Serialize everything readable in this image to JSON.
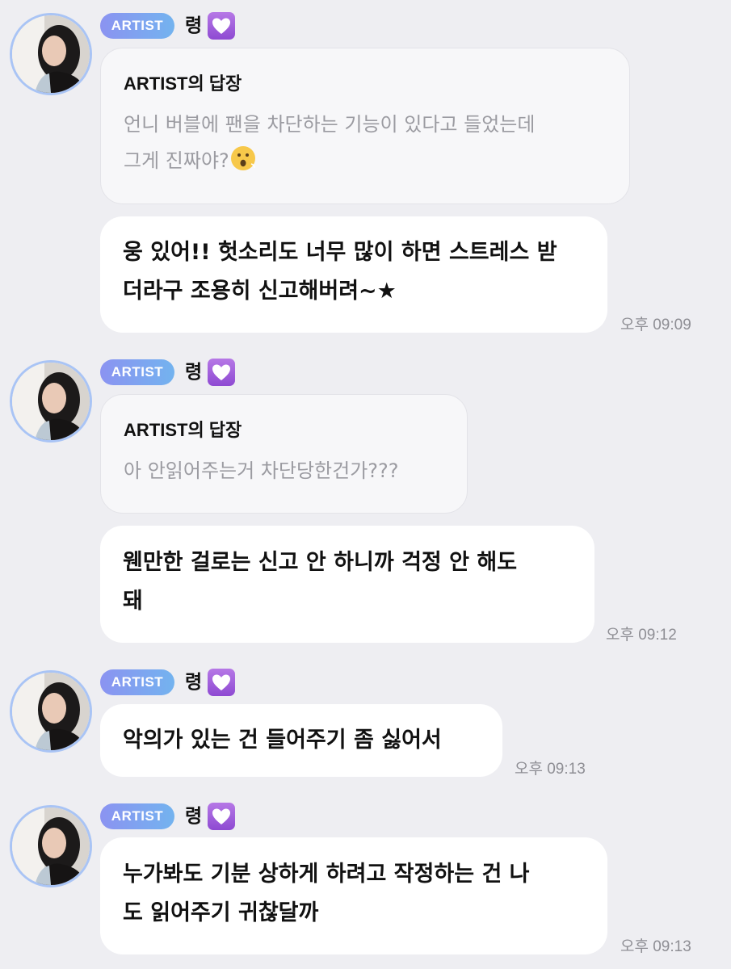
{
  "groups": [
    {
      "badge": "ARTIST",
      "username": "령",
      "reply": {
        "title": "ARTIST의 답장",
        "text": "언니 버블에 팬을 차단하는 기능이 있다고 들었는데\n그게 진짜야?",
        "emoji": "hushed-face-icon"
      },
      "message": "웅 있어!! 헛소리도 너무 많이 하면 스트레스 받\n더라구 조용히 신고해버려~★",
      "time": "오후 09:09"
    },
    {
      "badge": "ARTIST",
      "username": "령",
      "reply": {
        "title": "ARTIST의 답장",
        "text": "아 안읽어주는거 차단당한건가???"
      },
      "message": "웬만한 걸로는 신고 안 하니까 걱정 안 해도\n돼",
      "time": "오후 09:12"
    },
    {
      "badge": "ARTIST",
      "username": "령",
      "message": "악의가 있는 건 들어주기 좀 싫어서",
      "time": "오후 09:13"
    },
    {
      "badge": "ARTIST",
      "username": "령",
      "message": "누가봐도 기분 상하게 하려고 작정하는 건 나\n도 읽어주기 귀찮달까",
      "time": "오후 09:13"
    }
  ],
  "icons": {
    "badge_heart": "purple-heart-icon",
    "avatar": "avatar-photo"
  },
  "colors": {
    "background": "#eeeef2",
    "badge_gradient_start": "#8b93f1",
    "badge_gradient_end": "#73b3ef",
    "reply_text": "#9b9ba1",
    "timestamp": "#8e8e94",
    "avatar_ring": "#a9c4f5",
    "heart_box": "#9a57d8"
  }
}
